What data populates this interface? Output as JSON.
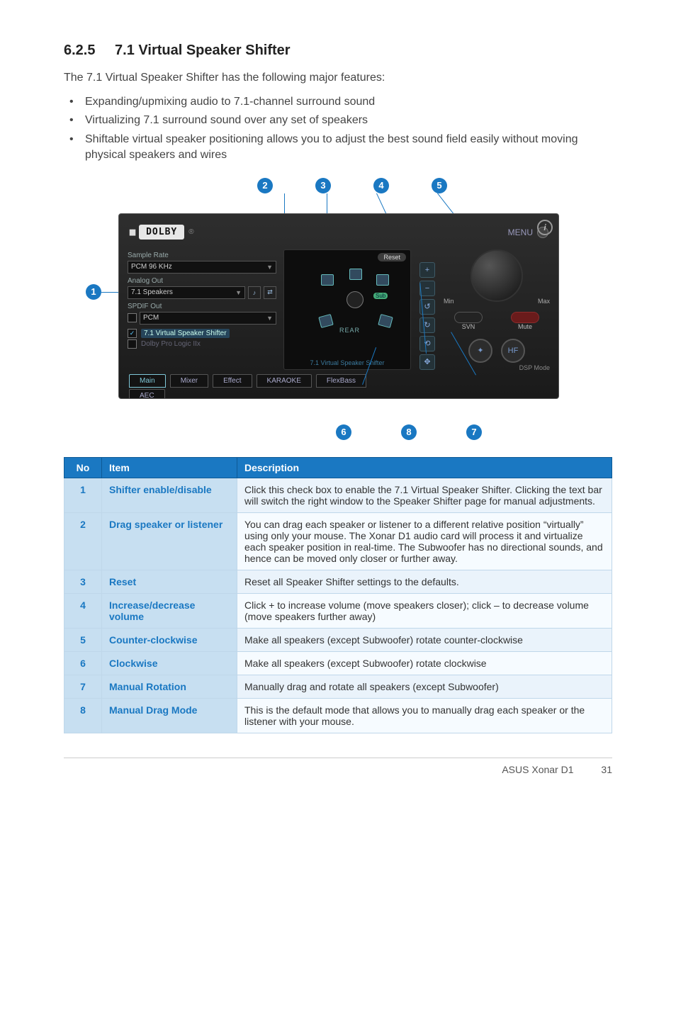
{
  "section": {
    "number": "6.2.5",
    "title": "7.1 Virtual Speaker Shifter"
  },
  "intro": "The 7.1 Virtual Speaker Shifter has the following major features:",
  "features": [
    "Expanding/upmixing audio to 7.1-channel surround sound",
    "Virtualizing 7.1 surround sound over any set of speakers",
    "Shiftable virtual speaker positioning allows you to adjust the best sound field easily without moving physical speakers and wires"
  ],
  "callouts_top": [
    "2",
    "3",
    "4",
    "5"
  ],
  "callout_left": "1",
  "callouts_bottom": [
    "6",
    "8",
    "7"
  ],
  "app": {
    "dolby": "DOLBY",
    "menu": "MENU",
    "info": "i",
    "left": {
      "sample_rate_lbl": "Sample Rate",
      "sample_rate_val": "PCM 96 KHz",
      "analog_out_lbl": "Analog Out",
      "analog_out_val": "7.1 Speakers",
      "spdif_out_lbl": "SPDIF Out",
      "spdif_out_val": "PCM",
      "shifter_chk": "7.1 Virtual Speaker Shifter",
      "dolby_chk": "Dolby Pro Logic IIx"
    },
    "mid": {
      "reset": "Reset",
      "sub": "Sub",
      "label": "7.1 Virtual Speaker Shifter"
    },
    "right": {
      "min": "Min",
      "max": "Max",
      "svn": "SVN",
      "mute": "Mute",
      "hf": "HF",
      "dspmode": "DSP Mode"
    },
    "tabs": [
      "Main",
      "Mixer",
      "Effect",
      "KARAOKE",
      "FlexBass"
    ],
    "tabs2": [
      "AEC"
    ]
  },
  "table": {
    "headers": {
      "no": "No",
      "item": "Item",
      "desc": "Description"
    },
    "rows": [
      {
        "no": "1",
        "item": "Shifter enable/disable",
        "desc": "Click this check box to enable the 7.1 Virtual Speaker Shifter. Clicking the text bar will switch the right window to the Speaker Shifter page for manual adjustments."
      },
      {
        "no": "2",
        "item": "Drag speaker or listener",
        "desc": "You can drag each speaker or listener to a different relative position “virtually” using only your mouse. The Xonar D1 audio card will process it and virtualize each speaker position in real-time. The Subwoofer has no directional sounds, and hence can be moved only closer or further away."
      },
      {
        "no": "3",
        "item": "Reset",
        "desc": "Reset all Speaker Shifter settings to the defaults."
      },
      {
        "no": "4",
        "item": "Increase/decrease volume",
        "desc": "Click + to increase volume (move speakers closer); click – to decrease volume (move speakers further away)"
      },
      {
        "no": "5",
        "item": "Counter-clockwise",
        "desc": "Make all speakers (except Subwoofer) rotate counter-clockwise"
      },
      {
        "no": "6",
        "item": "Clockwise",
        "desc": "Make all speakers (except Subwoofer) rotate clockwise"
      },
      {
        "no": "7",
        "item": "Manual Rotation",
        "desc": "Manually drag and rotate all speakers (except Subwoofer)"
      },
      {
        "no": "8",
        "item": "Manual Drag Mode",
        "desc": "This is the default mode that allows you to manually drag each speaker or the listener with your mouse."
      }
    ]
  },
  "footer": {
    "product": "ASUS Xonar D1",
    "page": "31"
  }
}
